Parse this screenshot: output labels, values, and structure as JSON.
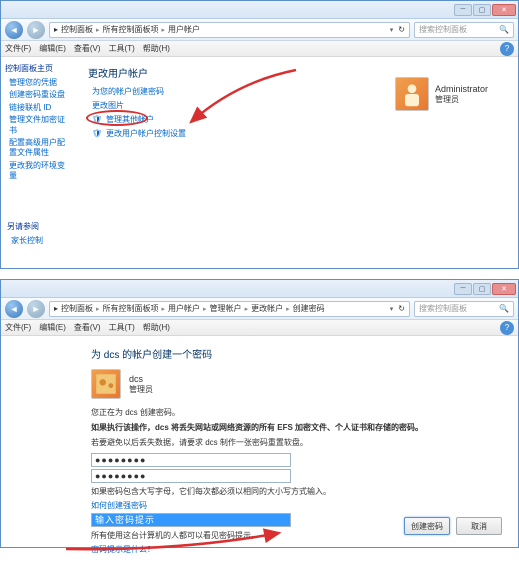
{
  "top": {
    "breadcrumbs": [
      "控制面板",
      "所有控制面板项",
      "用户帐户"
    ],
    "search_placeholder": "搜索控制面板",
    "menu": {
      "file": "文件(F)",
      "edit": "编辑(E)",
      "view": "查看(V)",
      "tools": "工具(T)",
      "help": "帮助(H)"
    },
    "sidebar": {
      "heading": "控制面板主页",
      "items": [
        "管理您的凭据",
        "创建密码重设盘",
        "链接联机 ID",
        "管理文件加密证书",
        "配置高级用户配置文件属性",
        "更改我的环境变量"
      ],
      "seealso_heading": "另请参阅",
      "seealso_item": "家长控制"
    },
    "main_title": "更改用户帐户",
    "links": {
      "l1": "为您的帐户创建密码",
      "l2": "更改图片",
      "l3_circled": "管理其他帐户",
      "l4": "更改用户帐户控制设置"
    },
    "account": {
      "name": "Administrator",
      "role": "管理员"
    }
  },
  "bottom": {
    "breadcrumbs": [
      "控制面板",
      "所有控制面板项",
      "用户帐户",
      "管理帐户",
      "更改帐户",
      "创建密码"
    ],
    "search_placeholder": "搜索控制面板",
    "menu": {
      "file": "文件(F)",
      "edit": "编辑(E)",
      "view": "查看(V)",
      "tools": "工具(T)",
      "help": "帮助(H)"
    },
    "page_title": "为 dcs 的帐户创建一个密码",
    "user": {
      "name": "dcs",
      "role": "管理员"
    },
    "desc1": "您正在为 dcs 创建密码。",
    "desc2": "如果执行该操作，dcs 将丢失网站或网络资源的所有 EFS 加密文件、个人证书和存储的密码。",
    "desc3": "若要避免以后丢失数据，请要求 dcs 制作一张密码重置软盘。",
    "pwd1": "●●●●●●●●",
    "pwd2": "●●●●●●●●",
    "hint1": "如果密码包含大写字母，它们每次都必须以相同的大小写方式输入。",
    "hint_link1": "如何创建强密码",
    "hint_placeholder": "输入密码提示",
    "hint2": "所有使用这台计算机的人都可以看见密码提示。",
    "hint_link2": "密码提示是什么？",
    "btn_create": "创建密码",
    "btn_cancel": "取消"
  }
}
